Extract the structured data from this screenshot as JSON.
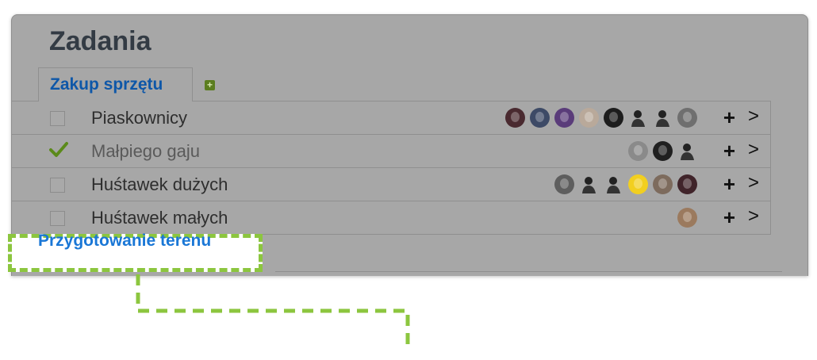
{
  "panel": {
    "title": "Zadania",
    "tab": {
      "label": "Zakup sprzętu",
      "add_icon": "plus-square-icon"
    },
    "tasks": [
      {
        "label": "Piaskownicy",
        "checked": false,
        "avatars": [
          "#4a2a30",
          "#3d4a66",
          "#5a3c7a",
          "#b9a99a",
          "#1d1d1d",
          "silhouette",
          "silhouette",
          "#6f6f6f"
        ]
      },
      {
        "label": "Małpiego gaju",
        "checked": true,
        "avatars": [
          "#8a8a8a",
          "#202020",
          "silhouette"
        ]
      },
      {
        "label": "Huśtawek dużych",
        "checked": false,
        "avatars": [
          "#5e5e5e",
          "silhouette",
          "silhouette",
          "#f2cf20",
          "#7d6b5d",
          "#40242a"
        ]
      },
      {
        "label": "Huśtawek małych",
        "checked": false,
        "avatars": [
          "#9b7a5e"
        ]
      }
    ],
    "row_actions": {
      "add_icon": "plus-icon",
      "open_icon": "chevron-right-icon"
    },
    "section_label": "Przygotowanie terenu"
  },
  "colors": {
    "overlay": "#a7a7a7",
    "highlight": "#8cc63f",
    "title": "#333b44",
    "tab_link": "#0e57a8",
    "section_link": "#1a77d6",
    "check": "#5b8a1a"
  }
}
